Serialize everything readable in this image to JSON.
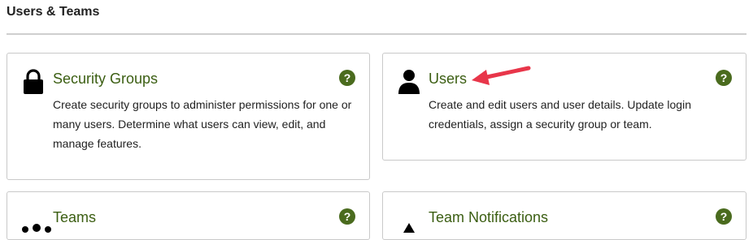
{
  "section": {
    "title": "Users & Teams"
  },
  "cards": [
    {
      "title": "Security Groups",
      "description": "Create security groups to administer permissions for one or many users. Determine what users can view, edit, and manage features.",
      "icon": "lock-icon",
      "help": "?"
    },
    {
      "title": "Users",
      "description": "Create and edit users and user details. Update login credentials, assign a security group or team.",
      "icon": "user-icon",
      "help": "?"
    },
    {
      "title": "Teams",
      "icon": "team-icon",
      "help": "?"
    },
    {
      "title": "Team Notifications",
      "icon": "warning-icon",
      "help": "?"
    }
  ],
  "colors": {
    "title_green": "#3b5e12",
    "help_green": "#4a6b1e",
    "annotation_red": "#e8364a"
  }
}
